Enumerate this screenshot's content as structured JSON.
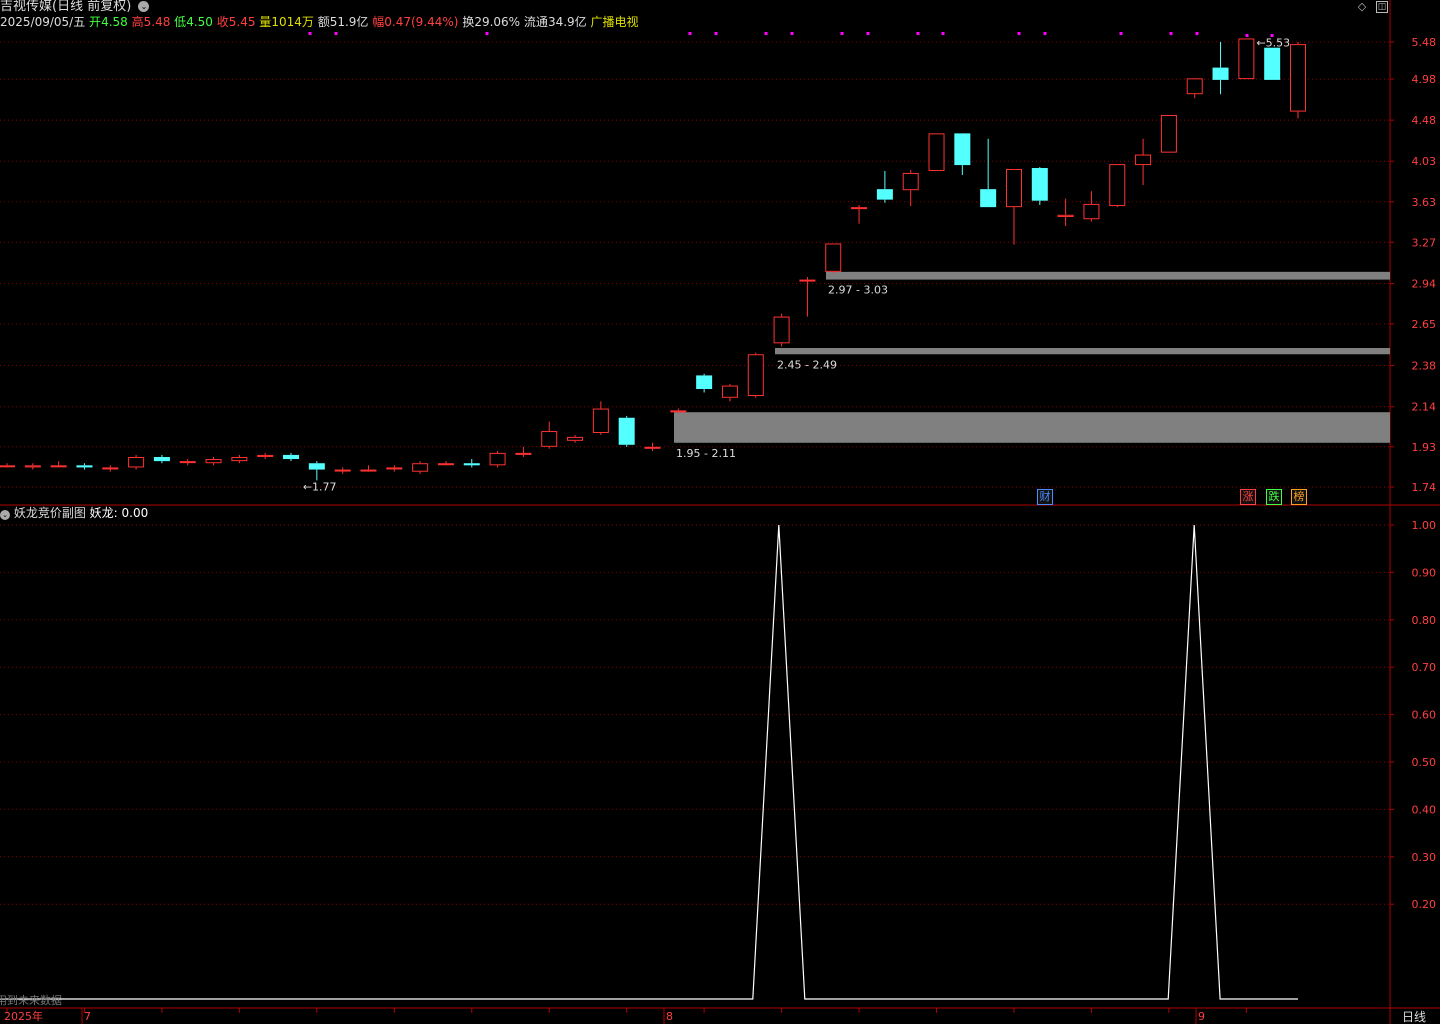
{
  "header": {
    "stock_name": "吉视传媒",
    "period_label": "(日线 前复权)",
    "date": "2025/09/05/五",
    "open_label": "开",
    "open": "4.58",
    "high_label": "高",
    "high": "5.48",
    "low_label": "低",
    "low": "4.50",
    "close_label": "收",
    "close": "5.45",
    "volume_label": "量",
    "volume": "1014万",
    "amount_label": "额",
    "amount": "51.9亿",
    "change_label": "幅",
    "change": "0.47(9.44%)",
    "turnover_label": "换",
    "turnover": "29.06%",
    "float_label": "流通",
    "float_cap": "34.9亿",
    "sector": "广播电视"
  },
  "indicator": {
    "name": "妖龙竞价副图",
    "value_text": "妖龙: 0.00",
    "warning": "用到未来数据"
  },
  "bottom_bar": {
    "year": "2025年",
    "months": [
      "7",
      "8",
      "9"
    ],
    "period_button": "日线"
  },
  "badges": [
    {
      "text": "财",
      "color": "#4a8cff"
    },
    {
      "text": "涨",
      "color": "#ff4040"
    },
    {
      "text": "跌",
      "color": "#40ff40"
    },
    {
      "text": "榜",
      "color": "#ffa020"
    }
  ],
  "colors": {
    "up": "#ff3232",
    "down": "#54ffff",
    "grid": "#8b0000",
    "zone": "#808080",
    "marker": "#ff00ff"
  },
  "chart_data": [
    {
      "type": "candlestick",
      "title": "吉视传媒 日线 前复权",
      "y_ticks": [
        5.48,
        4.98,
        4.48,
        4.03,
        3.63,
        3.27,
        2.94,
        2.65,
        2.38,
        2.14,
        1.93,
        1.74
      ],
      "ylim": [
        1.66,
        5.72
      ],
      "annotations": [
        "5.53",
        "1.77"
      ],
      "support_zones": [
        {
          "label": "1.95 - 2.11",
          "low": 1.95,
          "high": 2.11
        },
        {
          "label": "2.45 - 2.49",
          "low": 2.45,
          "high": 2.49
        },
        {
          "label": "2.97 - 3.03",
          "low": 2.97,
          "high": 3.03
        }
      ],
      "candles": [
        {
          "o": 1.84,
          "c": 1.84,
          "h": 1.85,
          "l": 1.83
        },
        {
          "o": 1.83,
          "c": 1.84,
          "h": 1.85,
          "l": 1.82
        },
        {
          "o": 1.84,
          "c": 1.84,
          "h": 1.86,
          "l": 1.83
        },
        {
          "o": 1.84,
          "c": 1.83,
          "h": 1.85,
          "l": 1.82
        },
        {
          "o": 1.83,
          "c": 1.83,
          "h": 1.84,
          "l": 1.81
        },
        {
          "o": 1.83,
          "c": 1.88,
          "h": 1.89,
          "l": 1.82
        },
        {
          "o": 1.88,
          "c": 1.86,
          "h": 1.89,
          "l": 1.85
        },
        {
          "o": 1.86,
          "c": 1.86,
          "h": 1.87,
          "l": 1.84
        },
        {
          "o": 1.85,
          "c": 1.87,
          "h": 1.88,
          "l": 1.84
        },
        {
          "o": 1.86,
          "c": 1.88,
          "h": 1.89,
          "l": 1.85
        },
        {
          "o": 1.88,
          "c": 1.89,
          "h": 1.9,
          "l": 1.87
        },
        {
          "o": 1.89,
          "c": 1.87,
          "h": 1.9,
          "l": 1.86
        },
        {
          "o": 1.85,
          "c": 1.82,
          "h": 1.86,
          "l": 1.77
        },
        {
          "o": 1.82,
          "c": 1.82,
          "h": 1.83,
          "l": 1.8
        },
        {
          "o": 1.82,
          "c": 1.82,
          "h": 1.84,
          "l": 1.81
        },
        {
          "o": 1.83,
          "c": 1.83,
          "h": 1.84,
          "l": 1.81
        },
        {
          "o": 1.81,
          "c": 1.85,
          "h": 1.86,
          "l": 1.8
        },
        {
          "o": 1.85,
          "c": 1.85,
          "h": 1.86,
          "l": 1.84
        },
        {
          "o": 1.85,
          "c": 1.84,
          "h": 1.87,
          "l": 1.83
        },
        {
          "o": 1.84,
          "c": 1.9,
          "h": 1.91,
          "l": 1.83
        },
        {
          "o": 1.9,
          "c": 1.9,
          "h": 1.93,
          "l": 1.88
        },
        {
          "o": 1.93,
          "c": 2.01,
          "h": 2.06,
          "l": 1.92
        },
        {
          "o": 1.96,
          "c": 1.98,
          "h": 1.99,
          "l": 1.95
        },
        {
          "o": 2.0,
          "c": 2.13,
          "h": 2.17,
          "l": 1.99
        },
        {
          "o": 2.08,
          "c": 1.94,
          "h": 2.09,
          "l": 1.93
        },
        {
          "o": 1.93,
          "c": 1.93,
          "h": 1.95,
          "l": 1.91
        },
        {
          "o": 2.12,
          "c": 2.12,
          "h": 2.13,
          "l": 2.11
        },
        {
          "o": 2.32,
          "c": 2.24,
          "h": 2.33,
          "l": 2.22
        },
        {
          "o": 2.19,
          "c": 2.26,
          "h": 2.27,
          "l": 2.17
        },
        {
          "o": 2.2,
          "c": 2.45,
          "h": 2.46,
          "l": 2.19
        },
        {
          "o": 2.52,
          "c": 2.7,
          "h": 2.72,
          "l": 2.5
        },
        {
          "o": 2.97,
          "c": 2.97,
          "h": 2.99,
          "l": 2.7
        },
        {
          "o": 3.03,
          "c": 3.26,
          "h": 3.26,
          "l": 3.02
        },
        {
          "o": 3.58,
          "c": 3.58,
          "h": 3.6,
          "l": 3.43
        },
        {
          "o": 3.75,
          "c": 3.65,
          "h": 3.93,
          "l": 3.62
        },
        {
          "o": 3.74,
          "c": 3.91,
          "h": 3.94,
          "l": 3.59
        },
        {
          "o": 3.93,
          "c": 4.33,
          "h": 4.33,
          "l": 3.93
        },
        {
          "o": 4.33,
          "c": 3.99,
          "h": 4.33,
          "l": 3.89
        },
        {
          "o": 3.75,
          "c": 3.58,
          "h": 4.27,
          "l": 3.58
        },
        {
          "o": 3.58,
          "c": 3.95,
          "h": 3.95,
          "l": 3.25
        },
        {
          "o": 3.96,
          "c": 3.64,
          "h": 3.97,
          "l": 3.6
        },
        {
          "o": 3.49,
          "c": 3.51,
          "h": 3.66,
          "l": 3.41
        },
        {
          "o": 3.47,
          "c": 3.61,
          "h": 3.73,
          "l": 3.45
        },
        {
          "o": 3.59,
          "c": 4.0,
          "h": 4.0,
          "l": 3.58
        },
        {
          "o": 3.99,
          "c": 4.1,
          "h": 4.27,
          "l": 3.79
        },
        {
          "o": 4.12,
          "c": 4.54,
          "h": 4.54,
          "l": 4.12
        },
        {
          "o": 4.79,
          "c": 4.99,
          "h": 4.99,
          "l": 4.74
        },
        {
          "o": 5.13,
          "c": 4.97,
          "h": 5.48,
          "l": 4.79
        },
        {
          "o": 4.98,
          "c": 5.53,
          "h": 5.53,
          "l": 4.98
        },
        {
          "o": 5.4,
          "c": 4.97,
          "h": 5.4,
          "l": 4.97
        },
        {
          "o": 4.58,
          "c": 5.45,
          "h": 5.48,
          "l": 4.5
        }
      ]
    },
    {
      "type": "line",
      "title": "妖龙竞价副图",
      "series": [
        {
          "name": "妖龙",
          "values": [
            0,
            0,
            0,
            0,
            0,
            0,
            0,
            0,
            0,
            0,
            0,
            0,
            0,
            0,
            0,
            0,
            0,
            0,
            0,
            0,
            0,
            0,
            0,
            0,
            0,
            0,
            0,
            0,
            0,
            0,
            1,
            0,
            0,
            0,
            0,
            0,
            0,
            0,
            0,
            0,
            0,
            0,
            0,
            0,
            0,
            0,
            1,
            0,
            0,
            0,
            0
          ]
        }
      ],
      "y_ticks": [
        1.0,
        0.9,
        0.8,
        0.7,
        0.6,
        0.5,
        0.4,
        0.3,
        0.2
      ],
      "ylim": [
        0,
        1.0
      ]
    }
  ]
}
